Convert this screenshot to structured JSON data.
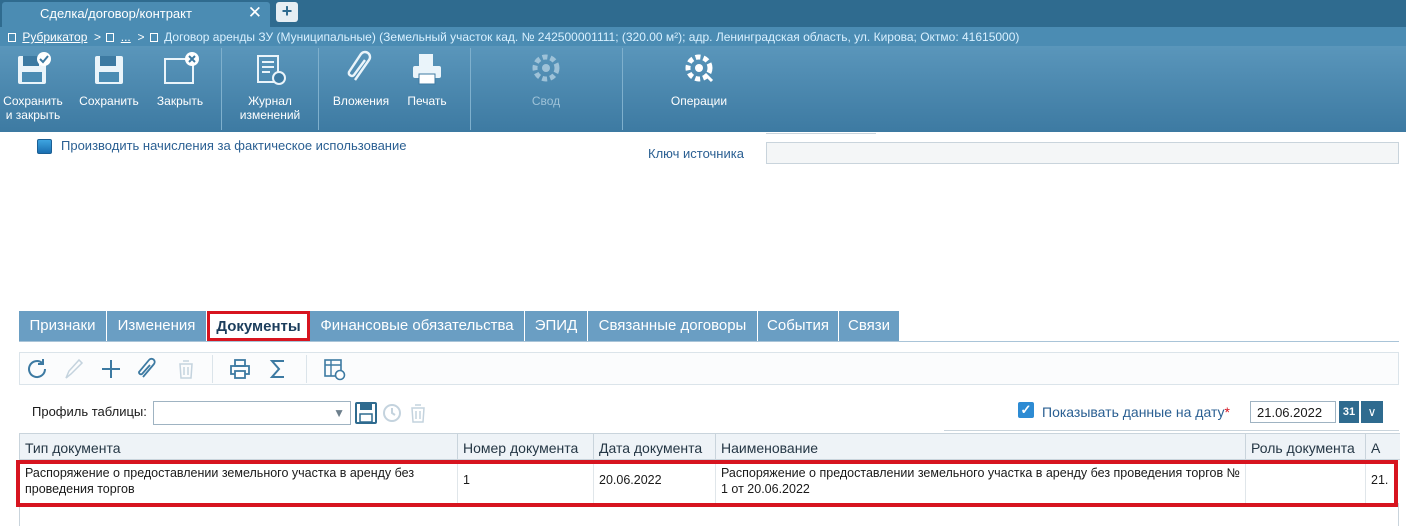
{
  "window": {
    "tab_title": "Сделка/договор/контракт",
    "new_tab": "+"
  },
  "breadcrumb": {
    "rubricator": "Рубрикатор",
    "ellipsis": "...",
    "document": "Договор аренды ЗУ (Муниципальные) (Земельный участок кад. № 242500001111; (320.00 м²); адр. Ленинградская область, ул. Кирова; Октмо: 41615000)"
  },
  "toolbar": {
    "save_close_line1": "Сохранить",
    "save_close_line2": "и закрыть",
    "save": "Сохранить",
    "close": "Закрыть",
    "journal_line1": "Журнал",
    "journal_line2": "изменений",
    "attachments": "Вложения",
    "print": "Печать",
    "summary": "Свод",
    "operations": "Операции"
  },
  "form": {
    "accrual_label": "Производить начисления за фактическое использование",
    "source_key_label": "Ключ источника",
    "source_key_value": ""
  },
  "tabs": [
    {
      "label": "Признаки"
    },
    {
      "label": "Изменения"
    },
    {
      "label": "Документы",
      "active": true
    },
    {
      "label": "Финансовые обязательства"
    },
    {
      "label": "ЭПИД"
    },
    {
      "label": "Связанные договоры"
    },
    {
      "label": "События"
    },
    {
      "label": "Связи"
    }
  ],
  "grid_toolbar_icons": [
    "refresh-icon",
    "edit-icon",
    "add-icon",
    "attach-icon",
    "delete-icon",
    "print-icon",
    "sum-icon",
    "columns-settings-icon"
  ],
  "profile": {
    "label": "Профиль таблицы:",
    "value": ""
  },
  "date_filter": {
    "label": "Показывать данные на дату",
    "required_mark": "*",
    "checked": true,
    "value": "21.06.2022",
    "calendar_label": "31"
  },
  "table": {
    "columns": [
      "Тип документа",
      "Номер документа",
      "Дата документа",
      "Наименование",
      "Роль документа",
      "А"
    ],
    "rows": [
      {
        "type": "Распоряжение о предоставлении земельного участка в аренду без проведения торгов",
        "number": "1",
        "date": "20.06.2022",
        "name": "Распоряжение о предоставлении земельного участка в аренду без проведения торгов № 1 от 20.06.2022",
        "role": "",
        "extra": "21."
      }
    ]
  },
  "colors": {
    "accent": "#2f6b8f",
    "toolbar": "#4b8cb3",
    "highlight": "#d7141f",
    "link": "#2a5f92"
  }
}
